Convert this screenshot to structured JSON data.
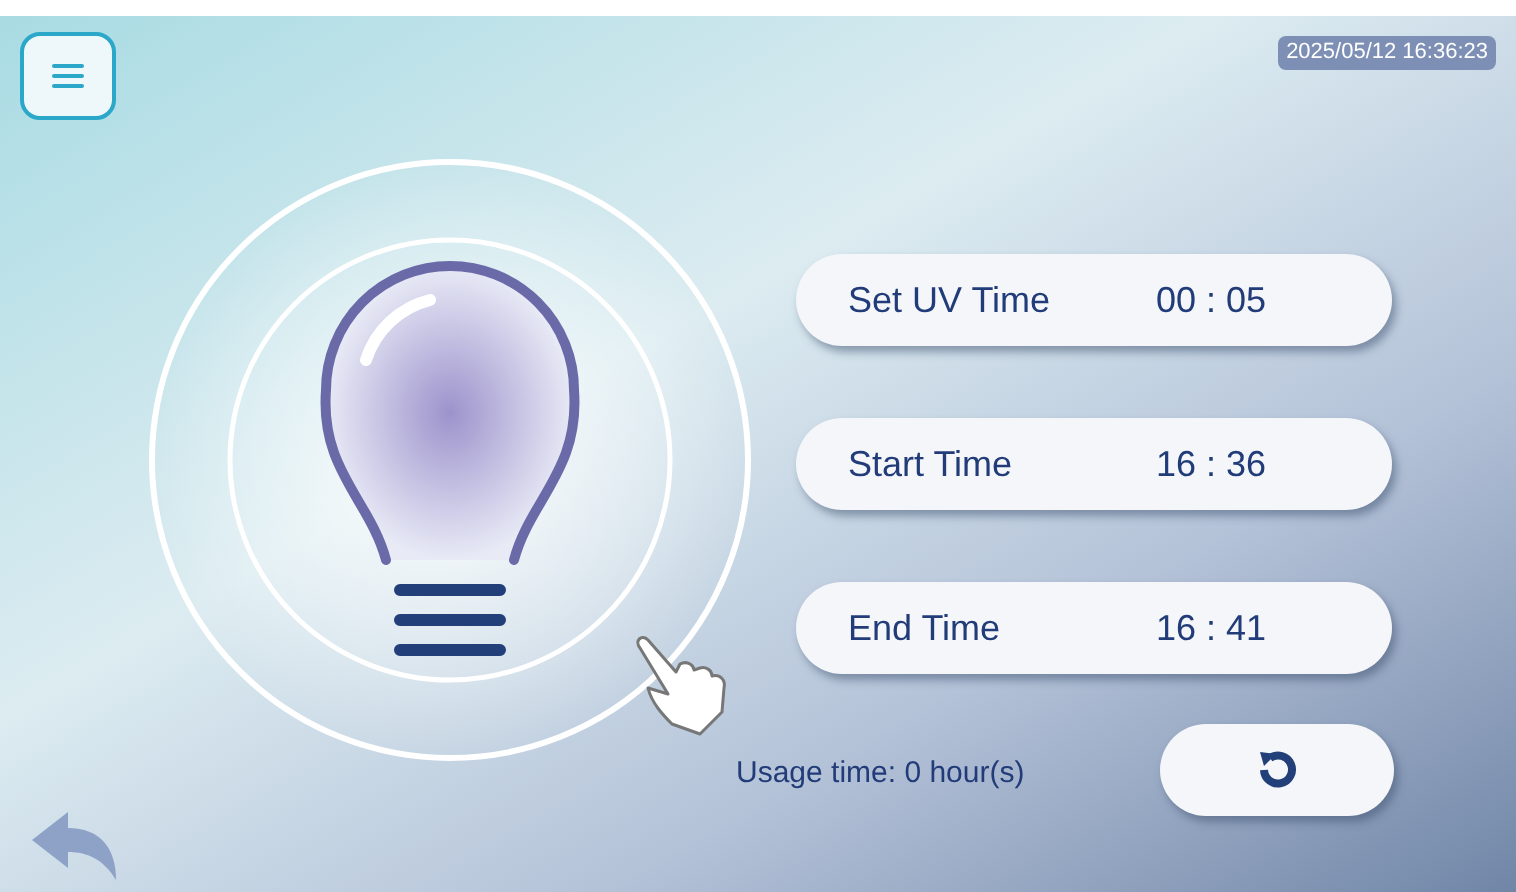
{
  "clock": "2025/05/12  16:36:23",
  "fields": [
    {
      "label": "Set UV Time",
      "value": "00 : 05"
    },
    {
      "label": "Start Time",
      "value": "16 : 36"
    },
    {
      "label": "End Time",
      "value": "16 : 41"
    }
  ],
  "usage": "Usage time:  0 hour(s)"
}
